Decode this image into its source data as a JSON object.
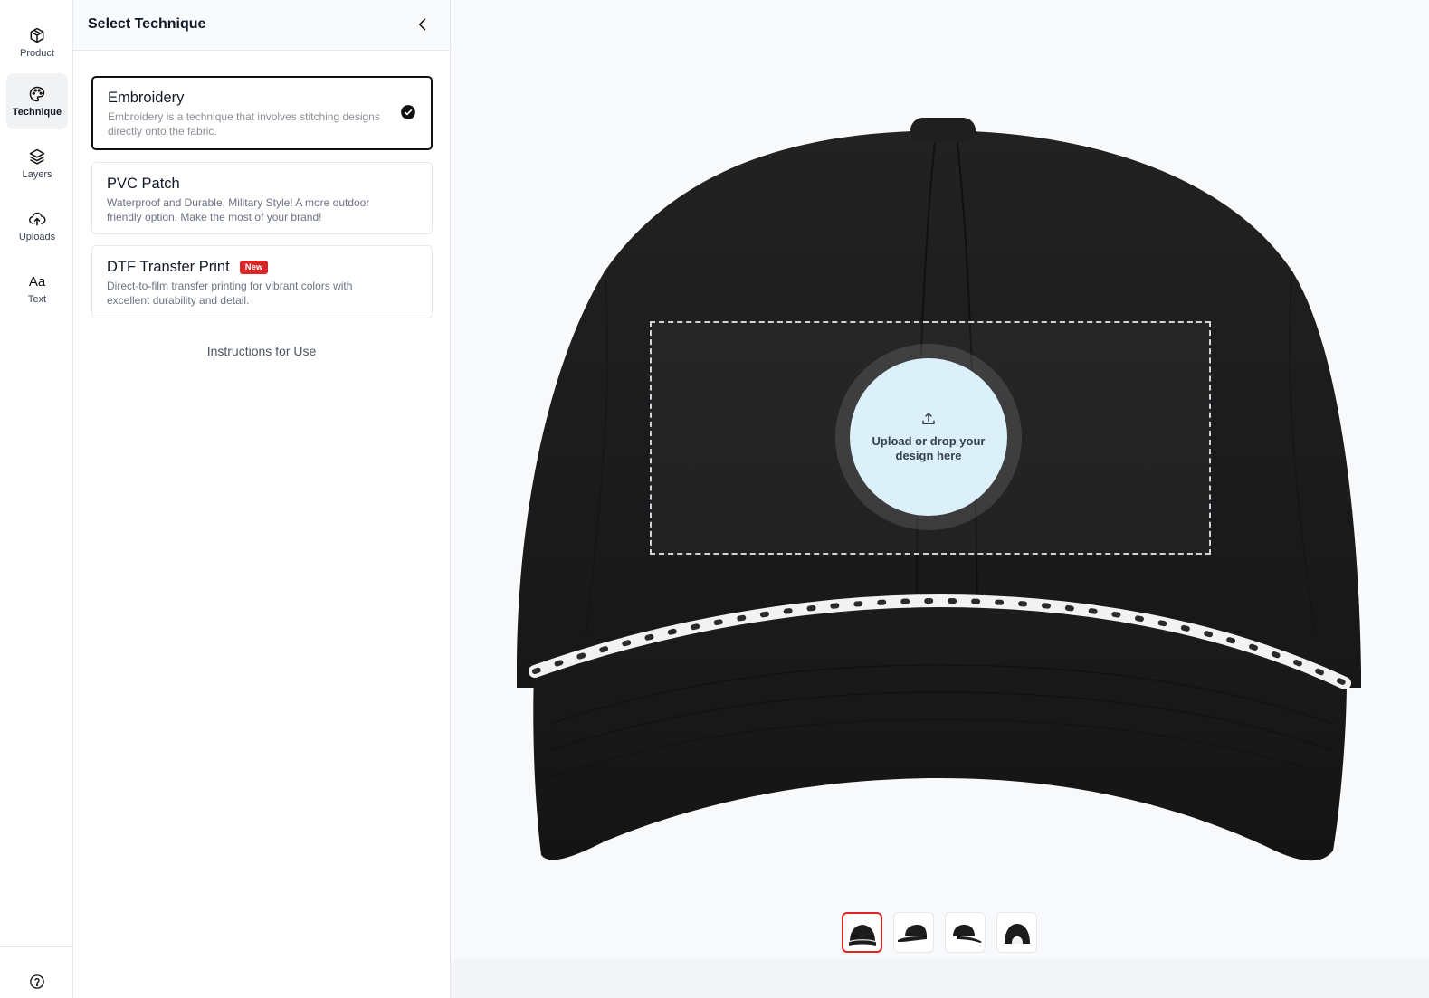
{
  "sidebar": {
    "items": [
      {
        "label": "Product",
        "icon": "box-icon"
      },
      {
        "label": "Technique",
        "icon": "palette-icon",
        "active": true
      },
      {
        "label": "Layers",
        "icon": "layers-icon"
      },
      {
        "label": "Uploads",
        "icon": "cloud-upload-icon"
      },
      {
        "label": "Text",
        "icon": "text-icon",
        "glyph": "Aa"
      }
    ],
    "help_icon": "help-circle-icon"
  },
  "panel": {
    "title": "Select Technique",
    "collapse_icon": "chevron-left-icon",
    "techniques": [
      {
        "name": "Embroidery",
        "description": "Embroidery is a technique that involves stitching designs directly onto the fabric.",
        "selected": true,
        "icon": "check-circle-icon"
      },
      {
        "name": "PVC Patch",
        "description": "Waterproof and Durable, Military Style! A more outdoor friendly option. Make the most of your brand!",
        "selected": false
      },
      {
        "name": "DTF Transfer Print",
        "badge": "New",
        "description": "Direct-to-film transfer printing for vibrant colors with excellent durability and detail.",
        "selected": false
      }
    ],
    "instructions_link": "Instructions for Use"
  },
  "canvas": {
    "drop_zone_text": "Upload or drop your design here",
    "upload_icon": "upload-icon",
    "product_color": "#1c1c1d",
    "rope_color": "#f2f2f2",
    "thumbnails": [
      {
        "view": "front",
        "active": true
      },
      {
        "view": "side",
        "active": false
      },
      {
        "view": "side-angle",
        "active": false
      },
      {
        "view": "back",
        "active": false
      }
    ]
  },
  "colors": {
    "accent": "#dc2626",
    "selected_border": "#111111",
    "drop_zone": "#dbf0f9"
  }
}
